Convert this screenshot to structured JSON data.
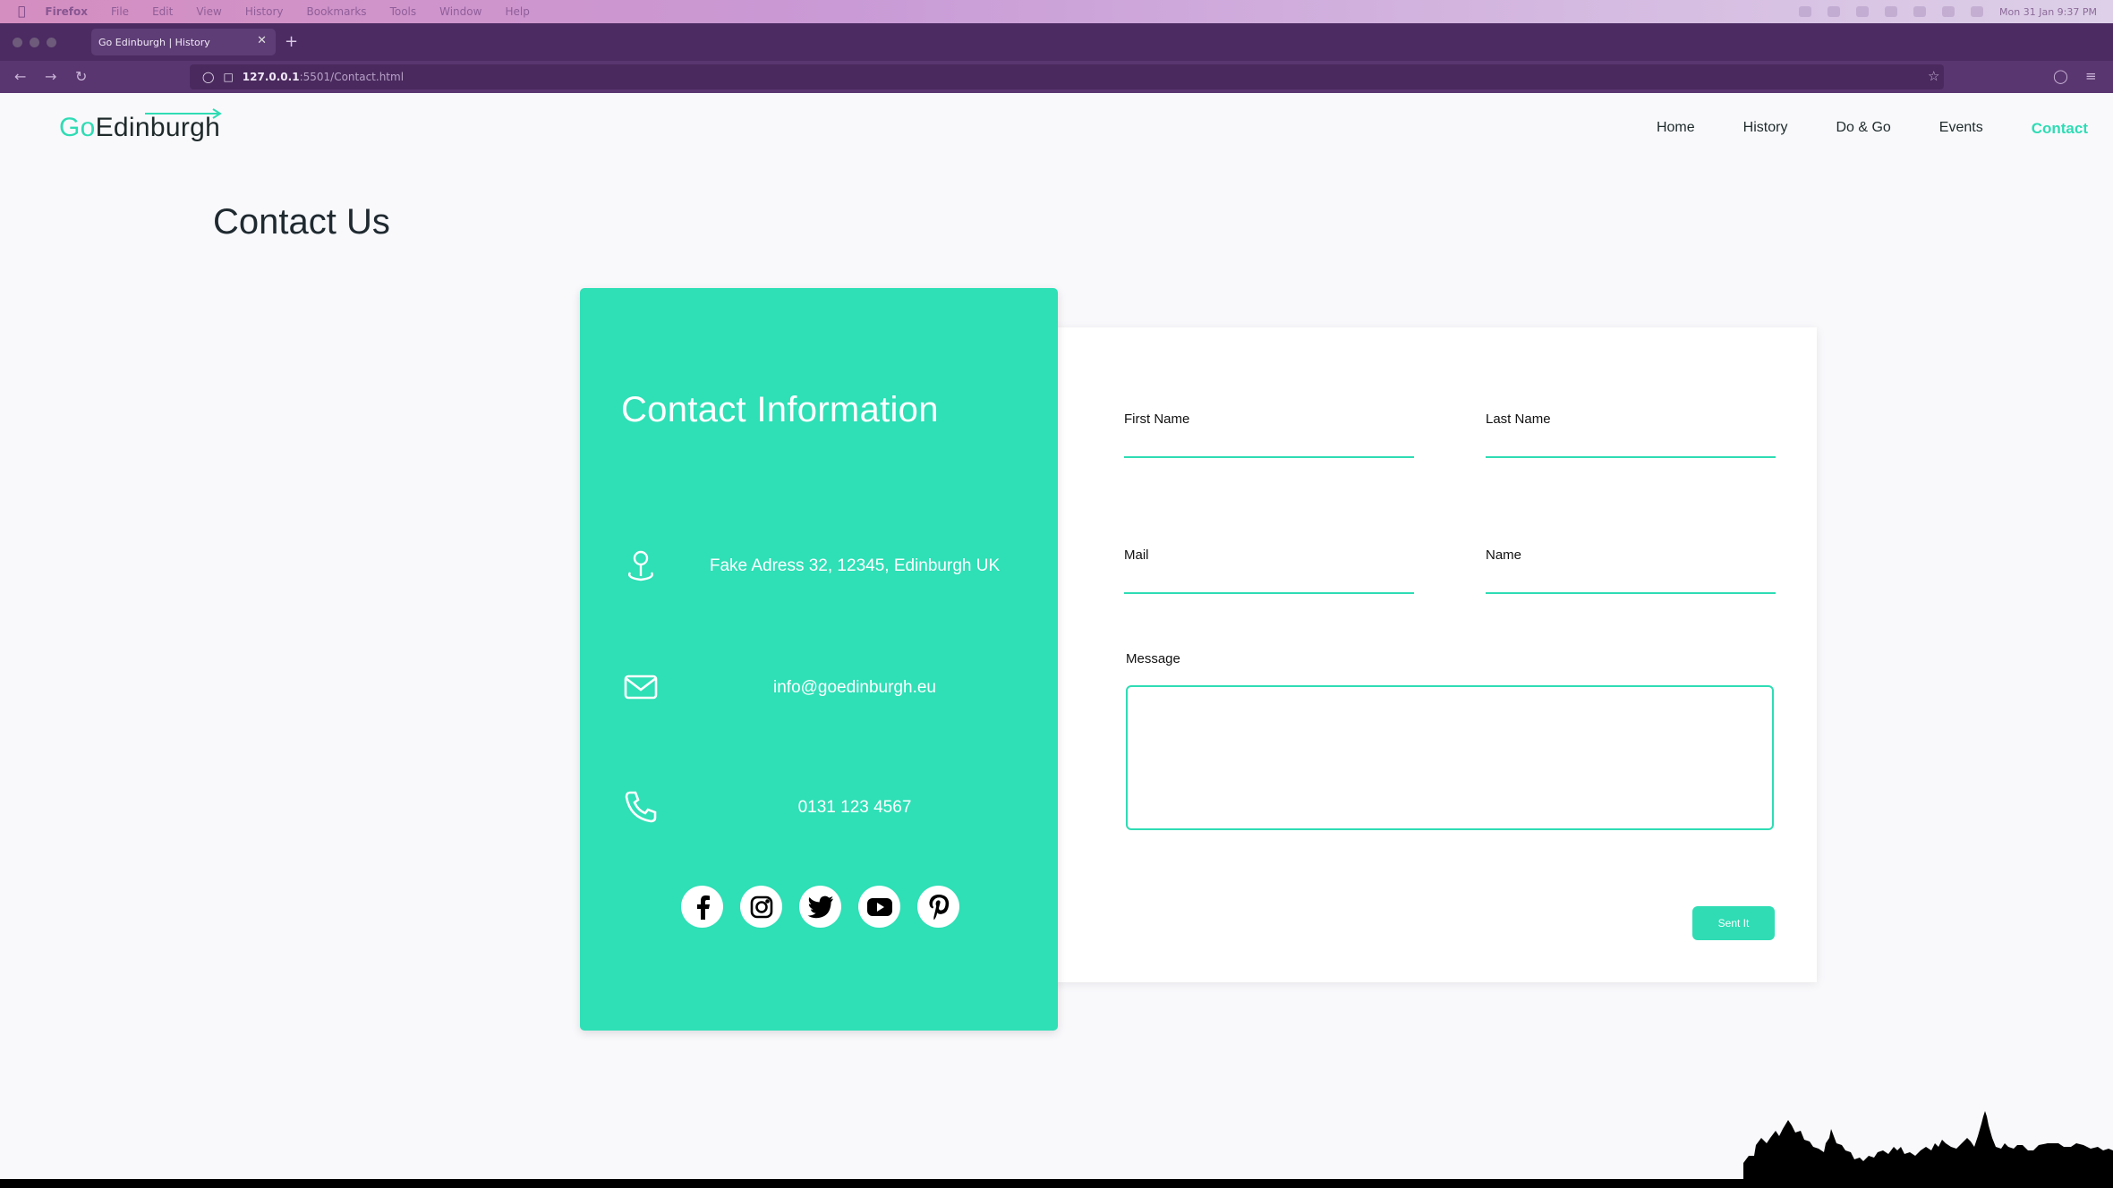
{
  "os_menubar": {
    "app_name": "Firefox",
    "menus": [
      "File",
      "Edit",
      "View",
      "History",
      "Bookmarks",
      "Tools",
      "Window",
      "Help"
    ],
    "clock": "Mon 31 Jan  9:37 PM"
  },
  "browser": {
    "tab_title": "Go Edinburgh | History",
    "url_host": "127.0.0.1",
    "url_rest": ":5501/Contact.html"
  },
  "site": {
    "logo_go": "Go",
    "logo_rest": "Edinburgh",
    "nav": [
      {
        "label": "Home"
      },
      {
        "label": "History"
      },
      {
        "label": "Do & Go"
      },
      {
        "label": "Events"
      },
      {
        "label": "Contact",
        "active": true
      }
    ],
    "accent_color": "#2fdcb4"
  },
  "page_title": "Contact Us",
  "contact_info": {
    "heading": "Contact Information",
    "address": "Fake Adress 32, 12345, Edinburgh UK",
    "email": "info@goedinburgh.eu",
    "phone": "0131 123 4567",
    "icons": [
      "location-pin-icon",
      "envelope-icon",
      "phone-icon"
    ],
    "socials": [
      "facebook-icon",
      "instagram-icon",
      "twitter-icon",
      "youtube-icon",
      "pinterest-icon"
    ]
  },
  "form": {
    "first_name_label": "First Name",
    "last_name_label": "Last Name",
    "mail_label": "Mail",
    "name_label": "Name",
    "message_label": "Message",
    "submit_label": "Sent It"
  }
}
